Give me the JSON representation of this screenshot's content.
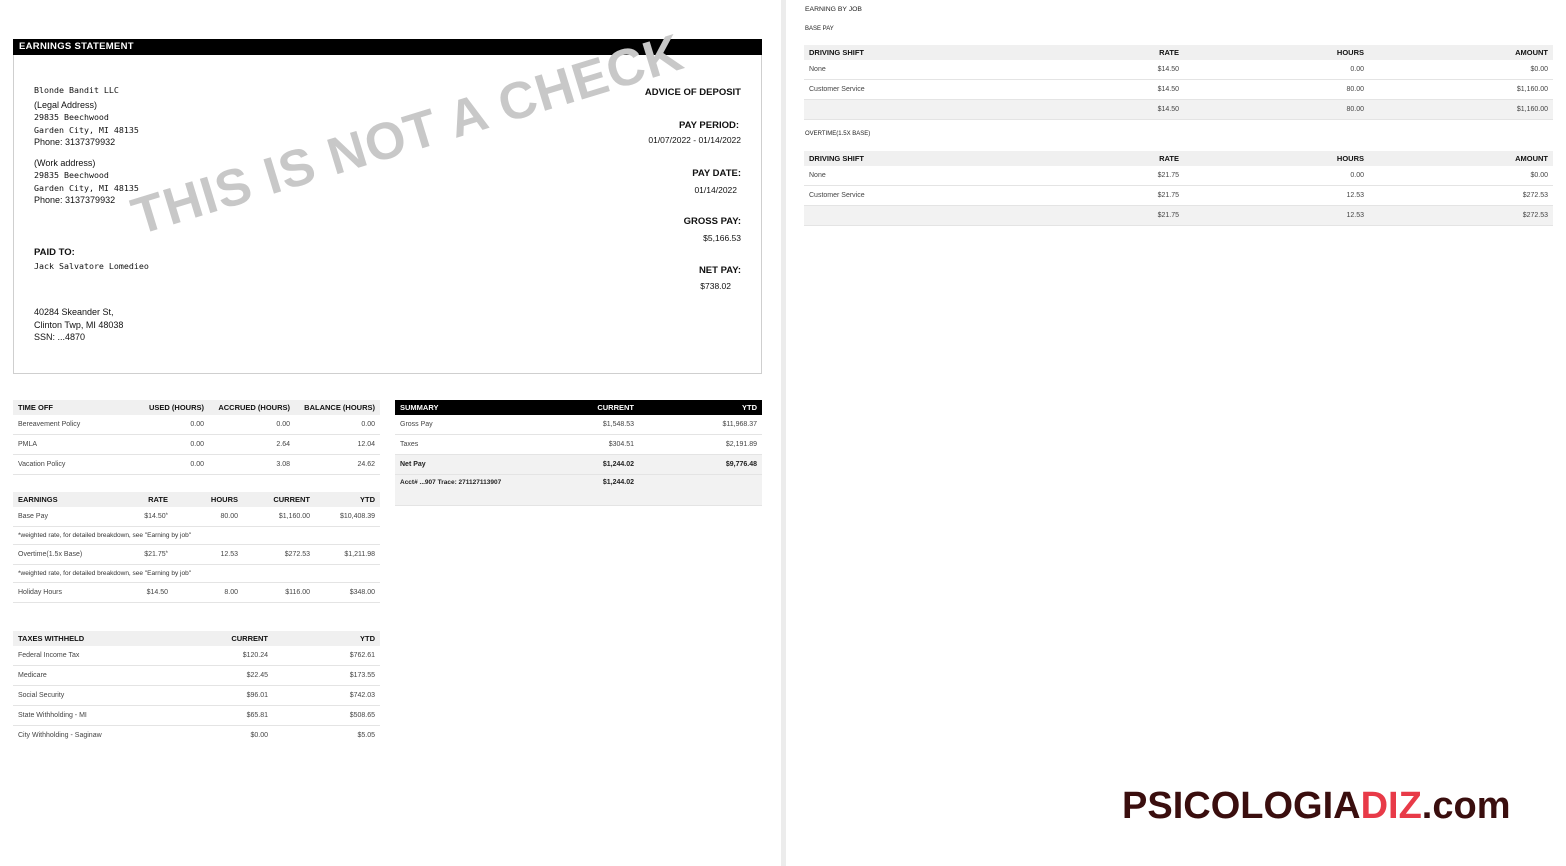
{
  "statement": {
    "header": "EARNINGS STATEMENT",
    "company": {
      "name": "Blonde Bandit LLC",
      "legal_label": "(Legal Address)",
      "legal_street": "29835 Beechwood",
      "legal_city": "Garden City, MI 48135",
      "legal_phone": "Phone: 3137379932",
      "work_label": "(Work address)",
      "work_street": "29835 Beechwood",
      "work_city": "Garden City, MI 48135",
      "work_phone": "Phone: 3137379932"
    },
    "paid_to": {
      "label": "PAID TO:",
      "name": "Jack Salvatore Lomedieo",
      "street": "40284 Skeander St,",
      "city": "Clinton Twp, MI 48038",
      "ssn": "SSN: ...4870"
    },
    "advice": "ADVICE OF DEPOSIT",
    "pay_period_label": "PAY PERIOD:",
    "pay_period": "01/07/2022 - 01/14/2022",
    "pay_date_label": "PAY DATE:",
    "pay_date": "01/14/2022",
    "gross_pay_label": "GROSS PAY:",
    "gross_pay": "$5,166.53",
    "net_pay_label": "NET PAY:",
    "net_pay": "$738.02",
    "watermark": "THIS IS NOT A CHECK"
  },
  "time_off": {
    "headers": [
      "TIME OFF",
      "USED (HOURS)",
      "ACCRUED (HOURS)",
      "BALANCE (HOURS)"
    ],
    "rows": [
      [
        "Bereavement Policy",
        "0.00",
        "0.00",
        "0.00"
      ],
      [
        "PMLA",
        "0.00",
        "2.64",
        "12.04"
      ],
      [
        "Vacation Policy",
        "0.00",
        "3.08",
        "24.62"
      ]
    ]
  },
  "earnings": {
    "headers": [
      "EARNINGS",
      "RATE",
      "HOURS",
      "CURRENT",
      "YTD"
    ],
    "rows": [
      [
        "Base Pay",
        "$14.50",
        "80.00",
        "$1,160.00",
        "$10,408.39"
      ],
      [
        "Overtime(1.5x Base)",
        "$21.75",
        "12.53",
        "$272.53",
        "$1,211.98"
      ],
      [
        "Holiday Hours",
        "$14.50",
        "8.00",
        "$116.00",
        "$348.00"
      ]
    ],
    "note": "*weighted rate, for detailed breakdown, see \"Earning by job\"",
    "star": "*"
  },
  "taxes": {
    "headers": [
      "TAXES WITHHELD",
      "CURRENT",
      "YTD"
    ],
    "rows": [
      [
        "Federal Income Tax",
        "$120.24",
        "$762.61"
      ],
      [
        "Medicare",
        "$22.45",
        "$173.55"
      ],
      [
        "Social Security",
        "$96.01",
        "$742.03"
      ],
      [
        "State Withholding - MI",
        "$65.81",
        "$508.65"
      ],
      [
        "City Withholding - Saginaw",
        "$0.00",
        "$5.05"
      ]
    ]
  },
  "summary": {
    "headers": [
      "SUMMARY",
      "CURRENT",
      "YTD"
    ],
    "rows": [
      [
        "Gross Pay",
        "$1,548.53",
        "$11,968.37"
      ],
      [
        "Taxes",
        "$304.51",
        "$2,191.89"
      ],
      [
        "Net Pay",
        "$1,244.02",
        "$9,776.48"
      ],
      [
        "Acct# ...907 Trace: 271127113907",
        "$1,244.02",
        ""
      ]
    ]
  },
  "earning_by_job": {
    "title": "EARNING BY JOB",
    "base": {
      "title": "BASE PAY",
      "headers": [
        "DRIVING SHIFT",
        "RATE",
        "HOURS",
        "AMOUNT"
      ],
      "rows": [
        [
          "None",
          "$14.50",
          "0.00",
          "$0.00"
        ],
        [
          "Customer Service",
          "$14.50",
          "80.00",
          "$1,160.00"
        ]
      ],
      "total": [
        "",
        "$14.50",
        "80.00",
        "$1,160.00"
      ]
    },
    "overtime": {
      "title": "OVERTIME(1.5X BASE)",
      "headers": [
        "DRIVING SHIFT",
        "RATE",
        "HOURS",
        "AMOUNT"
      ],
      "rows": [
        [
          "None",
          "$21.75",
          "0.00",
          "$0.00"
        ],
        [
          "Customer Service",
          "$21.75",
          "12.53",
          "$272.53"
        ]
      ],
      "total": [
        "",
        "$21.75",
        "12.53",
        "$272.53"
      ]
    }
  },
  "brand": {
    "part1": "PSICOLOGIA",
    "part2": "DIZ",
    "part3": ".com"
  }
}
